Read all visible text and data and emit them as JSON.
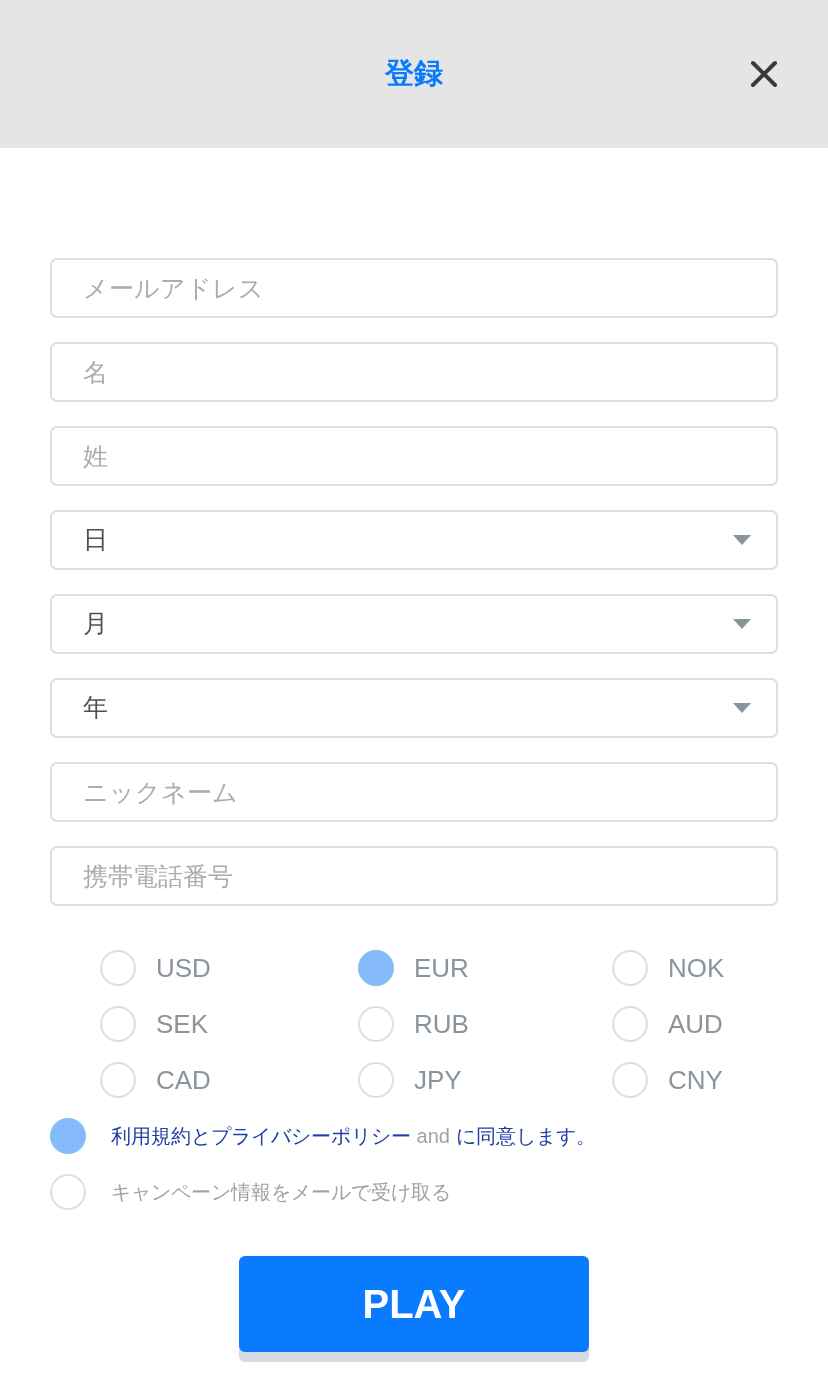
{
  "header": {
    "title": "登録"
  },
  "fields": [
    {
      "kind": "text",
      "placeholder": "メールアドレス"
    },
    {
      "kind": "text",
      "placeholder": "名"
    },
    {
      "kind": "text",
      "placeholder": "姓"
    },
    {
      "kind": "select",
      "value": "日"
    },
    {
      "kind": "select",
      "value": "月"
    },
    {
      "kind": "select",
      "value": "年"
    },
    {
      "kind": "text",
      "placeholder": "ニックネーム"
    },
    {
      "kind": "text",
      "placeholder": "携帯電話番号"
    }
  ],
  "currencies": [
    {
      "label": "USD",
      "selected": false
    },
    {
      "label": "EUR",
      "selected": true
    },
    {
      "label": "NOK",
      "selected": false
    },
    {
      "label": "SEK",
      "selected": false
    },
    {
      "label": "RUB",
      "selected": false
    },
    {
      "label": "AUD",
      "selected": false
    },
    {
      "label": "CAD",
      "selected": false
    },
    {
      "label": "JPY",
      "selected": false
    },
    {
      "label": "CNY",
      "selected": false
    }
  ],
  "options": [
    {
      "checked": true,
      "parts": [
        {
          "kind": "link",
          "text": "利用規約とプライバシーポリシー"
        },
        {
          "kind": "text",
          "text": "and"
        },
        {
          "kind": "link",
          "text": "に同意します。"
        }
      ]
    },
    {
      "checked": false,
      "parts": [
        {
          "kind": "text",
          "text": "キャンペーン情報をメールで受け取る"
        }
      ]
    }
  ],
  "submit": {
    "label": "PLAY"
  }
}
